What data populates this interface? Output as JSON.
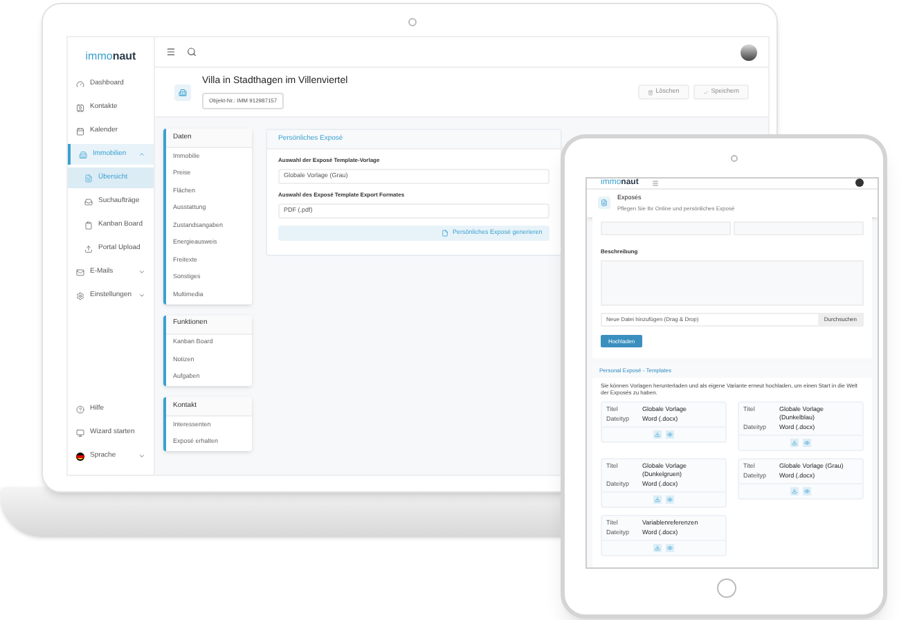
{
  "laptop": {
    "logo": {
      "prefix": "immo",
      "suffix": "naut"
    },
    "sidebar": {
      "items": [
        {
          "label": "Dashboard",
          "selected": false
        },
        {
          "label": "Kontakte",
          "selected": false
        },
        {
          "label": "Kalender",
          "selected": false
        },
        {
          "label": "Immobilien",
          "selected": true,
          "expanded": true,
          "children": [
            {
              "label": "Übersicht",
              "selected": true
            },
            {
              "label": "Suchaufträge",
              "selected": false
            },
            {
              "label": "Kanban Board",
              "selected": false
            },
            {
              "label": "Portal Upload",
              "selected": false
            }
          ]
        },
        {
          "label": "E-Mails",
          "selected": false,
          "expanded": false
        },
        {
          "label": "Einstellungen",
          "selected": false,
          "expanded": false
        }
      ],
      "bottom_items": [
        {
          "label": "Hilfe",
          "selected": false
        },
        {
          "label": "Wizard starten",
          "selected": false
        },
        {
          "label": "Sprache",
          "selected": false,
          "expanded": false
        }
      ]
    },
    "header": {
      "title": "Villa in Stadthagen im Villenviertel",
      "object_number": "Objekt-Nr.: IMM 912987157",
      "buttons": [
        {
          "label": "Löschen",
          "disabled": true
        },
        {
          "label": "Speichern",
          "disabled": true
        }
      ]
    },
    "nav_cards": [
      {
        "title": "Daten",
        "items": [
          "Immobilie",
          "Preise",
          "Flächen",
          "Ausstattung",
          "Zustandsangaben",
          "Energieausweis",
          "Freitexte",
          "Sonstiges",
          "Multimedia"
        ]
      },
      {
        "title": "Funktionen",
        "items": [
          "Kanban Board",
          "Notizen",
          "Aufgaben"
        ]
      },
      {
        "title": "Kontakt",
        "items": [
          "Interessenten",
          "Exposé erhalten"
        ]
      }
    ],
    "expose_panel": {
      "title": "Persönliches Exposé",
      "template_label": "Auswahl der Exposé Template-Vorlage",
      "template_value": "Globale Vorlage (Grau)",
      "format_label": "Auswahl des Exposé Template Export Formates",
      "format_value": "PDF (.pdf)",
      "generate_button": "Persönliches Exposé generieren"
    }
  },
  "tablet": {
    "logo": {
      "prefix": "immo",
      "suffix": "naut"
    },
    "header": {
      "title": "Exposés",
      "subtitle": "Pflegen Sie Ihr Online und persönliches Exposé"
    },
    "description_label": "Beschreibung",
    "file_field": {
      "placeholder": "Neue Datei hinzufügen (Drag & Drop)",
      "browse_button": "Durchsuchen"
    },
    "upload_button": "Hochladen",
    "templates": {
      "title": "Personal Exposé - Templates",
      "text": "Sie können Vorlagen herunterladen und als eigene Variante erneut hochladen, um einen Start in die Welt der Exposés zu haben.",
      "cards": [
        {
          "rows": [
            {
              "label": "Titel",
              "value": "Globale Vorlage"
            },
            {
              "label": "Dateityp",
              "value": "Word (.docx)"
            }
          ]
        },
        {
          "rows": [
            {
              "label": "Titel",
              "value": "Globale Vorlage (Dunkelblau)"
            },
            {
              "label": "Dateityp",
              "value": "Word (.docx)"
            }
          ]
        },
        {
          "rows": [
            {
              "label": "Titel",
              "value": "Globale Vorlage (Dunkelgruen)"
            },
            {
              "label": "Dateityp",
              "value": "Word (.docx)"
            }
          ]
        },
        {
          "rows": [
            {
              "label": "Titel",
              "value": "Globale Vorlage (Grau)"
            },
            {
              "label": "Dateityp",
              "value": "Word (.docx)"
            }
          ]
        },
        {
          "rows": [
            {
              "label": "Titel",
              "value": "Variablenreferenzen"
            },
            {
              "label": "Dateityp",
              "value": "Word (.docx)"
            }
          ]
        }
      ]
    }
  }
}
